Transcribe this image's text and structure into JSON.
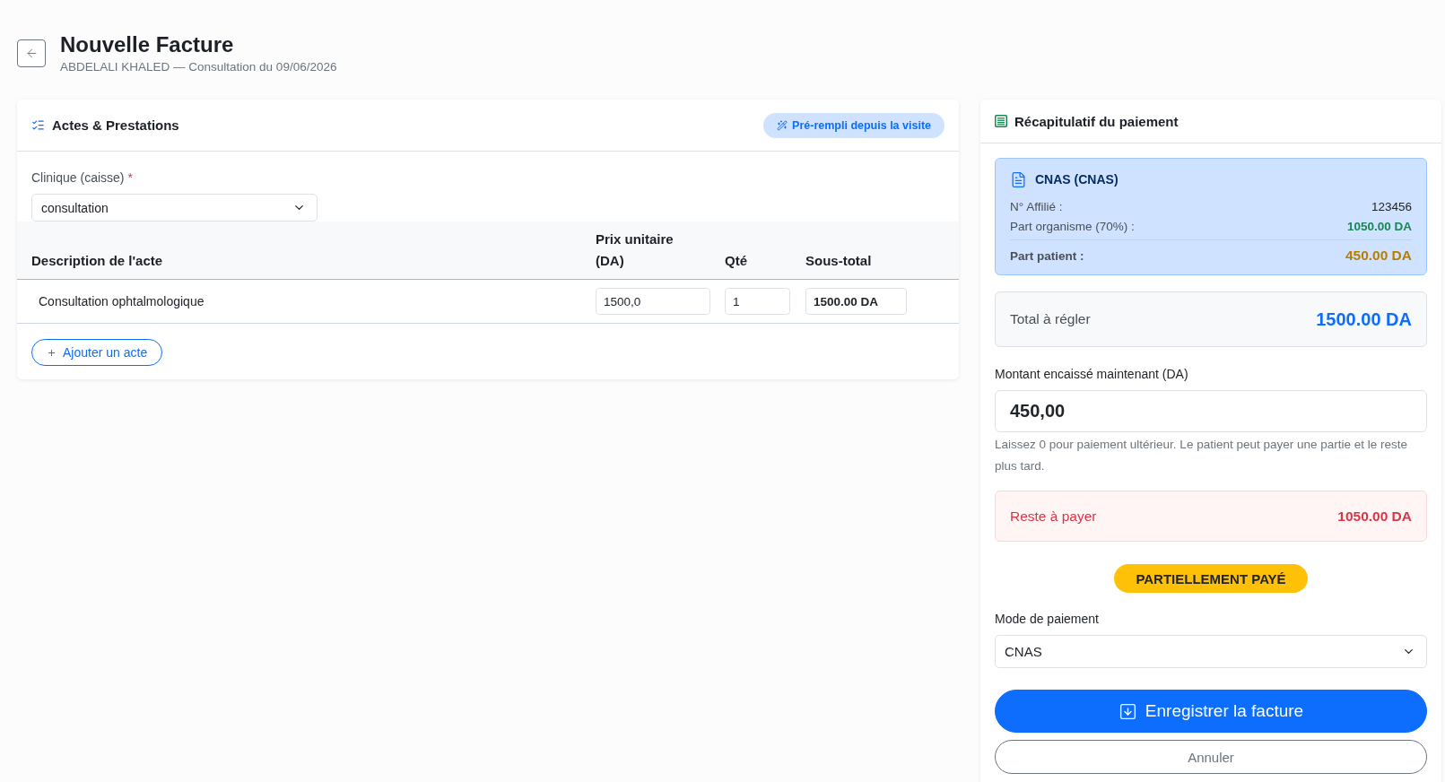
{
  "header": {
    "title": "Nouvelle Facture",
    "subtitle": "ABDELALI KHALED — Consultation du 09/06/2026"
  },
  "acts_card": {
    "title": "Actes & Prestations",
    "prefill_badge": "Pré-rempli depuis la visite",
    "clinic_field": {
      "label": "Clinique (caisse)",
      "required_mark": "*",
      "value": "consultation"
    },
    "table": {
      "columns": [
        "Description de l'acte",
        "Prix unitaire (DA)",
        "Qté",
        "Sous-total"
      ],
      "rows": [
        {
          "description": "Consultation ophtalmologique",
          "unit_price": "1500,0",
          "quantity": "1",
          "subtotal": "1500.00 DA"
        }
      ]
    },
    "add_button": "Ajouter un acte"
  },
  "summary_card": {
    "title": "Récapitulatif du paiement",
    "insurance": {
      "name": "CNAS (CNAS)",
      "lines": [
        {
          "label": "N° Affilié :",
          "value": "123456",
          "kind": "plain"
        },
        {
          "label": "Part organisme (70%) :",
          "value": "1050.00 DA",
          "kind": "organism"
        },
        {
          "label": "Part patient :",
          "value": "450.00 DA",
          "kind": "patient"
        }
      ]
    },
    "total": {
      "label": "Total à régler",
      "value": "1500.00 DA"
    },
    "amount_field": {
      "label": "Montant encaissé maintenant (DA)",
      "value": "450,00",
      "hint": "Laissez 0 pour paiement ultérieur. Le patient peut payer une partie et le reste plus tard."
    },
    "remaining": {
      "label": "Reste à payer",
      "value": "1050.00 DA"
    },
    "status_badge": {
      "label": "PARTIELLEMENT PAYÉ",
      "kind": "partial"
    },
    "payment_mode": {
      "label": "Mode de paiement",
      "value": "CNAS"
    },
    "buttons": [
      {
        "label": "Enregistrer la facture",
        "kind": "primary"
      },
      {
        "label": "Annuler",
        "kind": "secondary"
      }
    ]
  }
}
